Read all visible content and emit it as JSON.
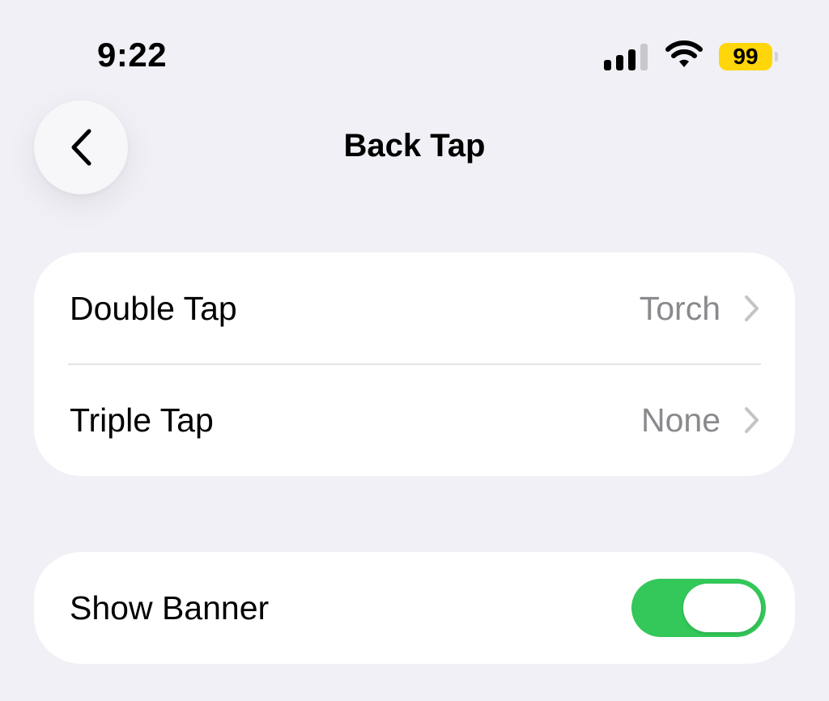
{
  "status_bar": {
    "time": "9:22",
    "battery_level": "99",
    "battery_color": "#ffd60a",
    "signal_bars_active": 3,
    "signal_bars_total": 4,
    "icons": [
      "signal-icon",
      "wifi-icon",
      "battery-icon"
    ]
  },
  "nav": {
    "title": "Back Tap",
    "back_icon": "chevron-left-icon"
  },
  "settings": {
    "tap_actions": [
      {
        "label": "Double Tap",
        "value": "Torch"
      },
      {
        "label": "Triple Tap",
        "value": "None"
      }
    ],
    "show_banner": {
      "label": "Show Banner",
      "enabled": true,
      "toggle_color": "#34c759"
    }
  }
}
